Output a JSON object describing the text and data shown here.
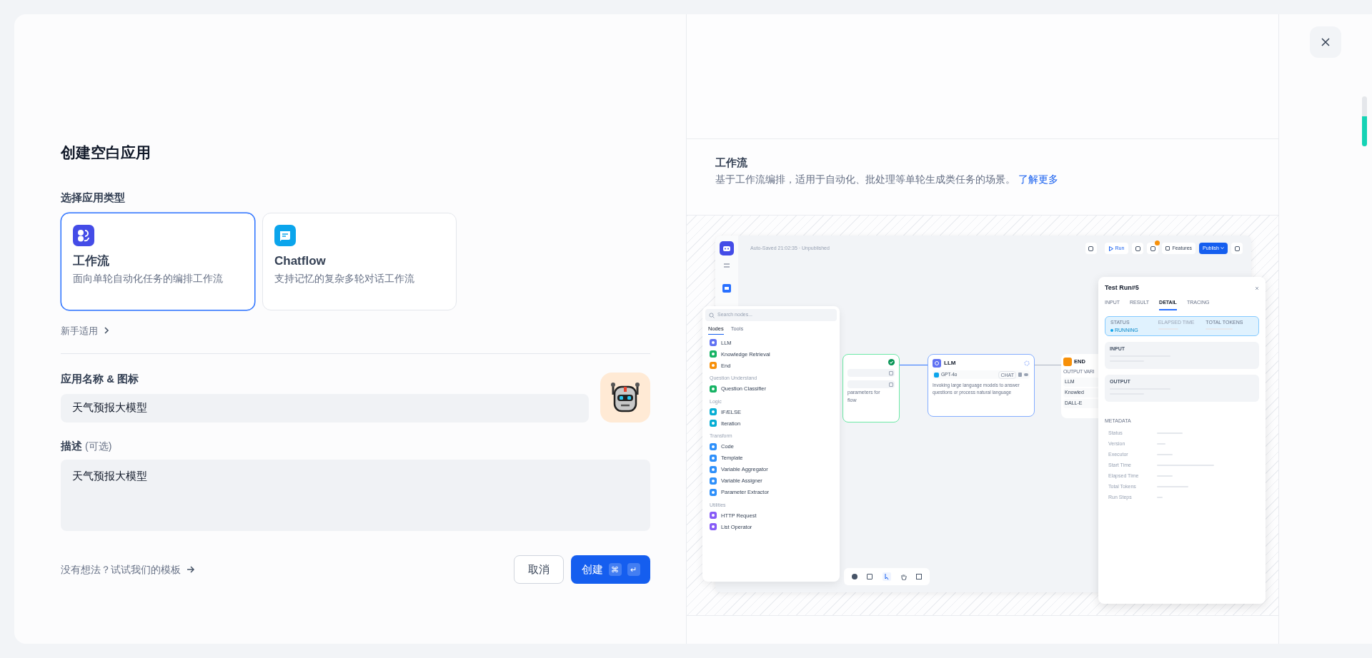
{
  "dialog": {
    "title": "创建空白应用",
    "type_label": "选择应用类型",
    "app_types": [
      {
        "kind": "workflow",
        "title": "工作流",
        "description": "面向单轮自动化任务的编排工作流",
        "selected": true,
        "color": "#444ce7"
      },
      {
        "kind": "chatflow",
        "title": "Chatflow",
        "description": "支持记忆的复杂多轮对话工作流",
        "selected": false,
        "color": "#0ba5ec"
      }
    ],
    "beginner_link": "新手适用",
    "name_label": "应用名称 & 图标",
    "name_value": "天气预报大模型",
    "description_label": "描述",
    "description_optional": "(可选)",
    "description_value": "天气预报大模型",
    "template_link": "没有想法？试试我们的模板",
    "cancel": "取消",
    "create": "创建",
    "create_keys": [
      "⌘",
      "↵"
    ]
  },
  "preview": {
    "title": "工作流",
    "description": "基于工作流编排，适用于自动化、批处理等单轮生成类任务的场景。",
    "learn_more": "了解更多",
    "app": {
      "autosave": "Auto-Saved 21:02:35 · Unpublished",
      "run": "Run",
      "features": "Features",
      "publish": "Publish",
      "node_panel": {
        "placeholder": "Search nodes...",
        "tabs": [
          {
            "label": "Nodes",
            "selected": true
          },
          {
            "label": "Tools",
            "selected": false
          }
        ],
        "groups": [
          {
            "items": [
              {
                "label": "LLM",
                "color": "#6172f3"
              },
              {
                "label": "Knowledge Retrieval",
                "color": "#16b364"
              },
              {
                "label": "End",
                "color": "#f79009"
              }
            ]
          },
          {
            "title": "Question Understand",
            "items": [
              {
                "label": "Question Classifier",
                "color": "#16b364"
              }
            ]
          },
          {
            "title": "Logic",
            "items": [
              {
                "label": "IF/ELSE",
                "color": "#06aed4"
              },
              {
                "label": "Iteration",
                "color": "#06aed4"
              }
            ]
          },
          {
            "title": "Transform",
            "items": [
              {
                "label": "Code",
                "color": "#2e90fa"
              },
              {
                "label": "Template",
                "color": "#2e90fa"
              },
              {
                "label": "Variable Aggregator",
                "color": "#2e90fa"
              },
              {
                "label": "Variable Assigner",
                "color": "#2e90fa"
              },
              {
                "label": "Parameter Extractor",
                "color": "#2e90fa"
              }
            ]
          },
          {
            "title": "Utilities",
            "items": [
              {
                "label": "HTTP Request",
                "color": "#875bf7"
              },
              {
                "label": "List Operator",
                "color": "#875bf7"
              }
            ]
          }
        ]
      },
      "start_node": {
        "lines": [
          "parameters for",
          "flow"
        ]
      },
      "llm_node": {
        "title": "LLM",
        "model": "GPT-4o",
        "mode": "CHAT",
        "description": "Invoking large language models to answer questions or process natural language"
      },
      "end_node": {
        "title": "END",
        "subtitle": "OUTPUT VARI",
        "outputs": [
          "LLM",
          "Knowled",
          "DALL-E"
        ]
      },
      "test_run": {
        "title": "Test Run#5",
        "tabs": [
          {
            "label": "INPUT",
            "selected": false
          },
          {
            "label": "RESULT",
            "selected": false
          },
          {
            "label": "DETAIL",
            "selected": true
          },
          {
            "label": "TRACING",
            "selected": false
          }
        ],
        "status_label": "STATUS",
        "status": "RUNNING",
        "elapsed_label": "ELAPSED TIME",
        "tokens_label": "TOTAL TOKENS",
        "sections": [
          "INPUT",
          "OUTPUT"
        ],
        "metadata_title": "METADATA",
        "metadata": [
          "Status",
          "Version",
          "Executor",
          "Start Time",
          "Elapsed Time",
          "Total Tokens",
          "Run Steps"
        ]
      }
    }
  }
}
